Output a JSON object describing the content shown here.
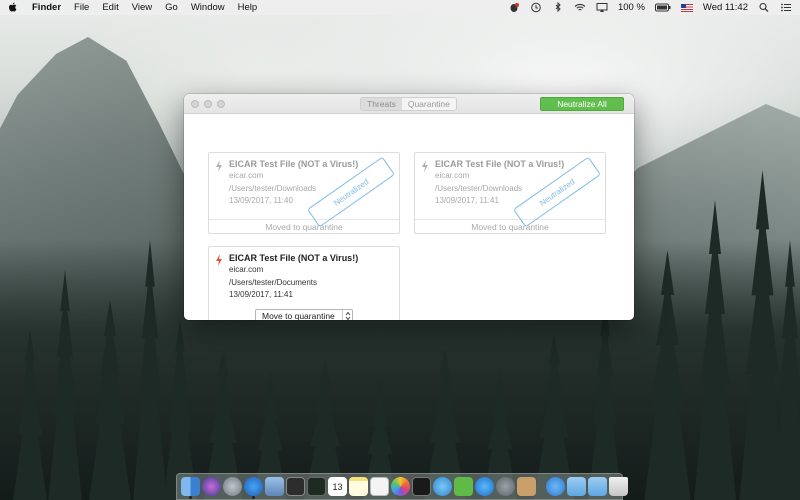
{
  "menubar": {
    "app_name": "Finder",
    "items": [
      "File",
      "Edit",
      "View",
      "Go",
      "Window",
      "Help"
    ],
    "battery": "100 %",
    "clock": "Wed 11:42"
  },
  "window": {
    "tabs": [
      {
        "label": "Threats",
        "active": true
      },
      {
        "label": "Quarantine",
        "active": false
      }
    ],
    "neutralize_all_label": "Neutralize All",
    "accent_color": "#62bd4f",
    "stamp_color": "#7fbce6"
  },
  "threats": [
    {
      "title": "EICAR Test File (NOT a Virus!)",
      "domain": "eicar.com",
      "path": "/Users/tester/Downloads",
      "date": "13/09/2017, 11:40",
      "status": "Moved to quarantine",
      "stamp": "Neutralized"
    },
    {
      "title": "EICAR Test File (NOT a Virus!)",
      "domain": "eicar.com",
      "path": "/Users/tester/Downloads",
      "date": "13/09/2017, 11:41",
      "status": "Moved to quarantine",
      "stamp": "Neutralized"
    },
    {
      "title": "EICAR Test File (NOT a Virus!)",
      "domain": "eicar.com",
      "path": "/Users/tester/Documents",
      "date": "13/09/2017, 11:41",
      "action_selected": "Move to quarantine"
    }
  ],
  "dock": {
    "icons": [
      "finder-icon",
      "siri-icon",
      "launchpad-icon",
      "safari-icon",
      "preview-icon",
      "disk-icon",
      "activity-monitor-icon",
      "calendar-icon",
      "notes-icon",
      "textedit-icon",
      "photos-icon",
      "terminal-icon",
      "finder-sync-icon",
      "evernote-icon",
      "app-store-icon",
      "system-preferences-icon",
      "xcode-icon",
      "folder-icon",
      "downloads-icon",
      "trash-icon"
    ]
  }
}
